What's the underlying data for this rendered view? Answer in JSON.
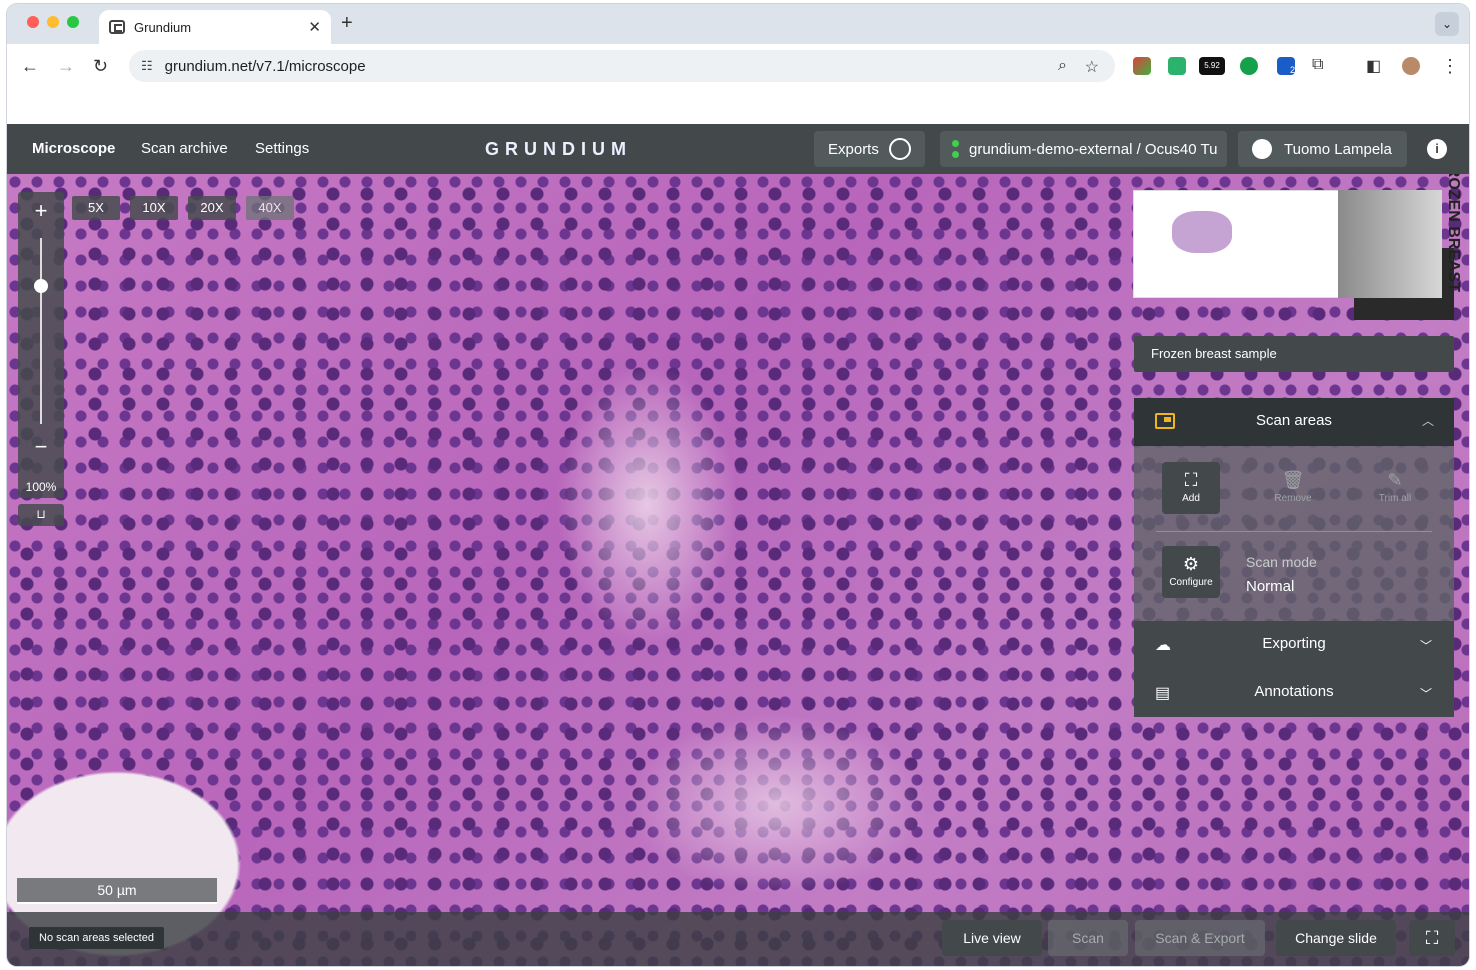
{
  "browser": {
    "tab_title": "Grundium",
    "tab_close": "✕",
    "new_tab": "+",
    "tab_menu": "⌄",
    "url": "grundium.net/v7.1/microscope",
    "ext_badge_value": "5.92",
    "ext_badge_count": "2",
    "icons": [
      "back-icon",
      "forward-icon",
      "reload-icon",
      "tune-icon",
      "zoom-icon",
      "star-icon",
      "extension-icon",
      "sidebar-icon",
      "profile-avatar",
      "more-icon"
    ]
  },
  "app": {
    "nav": {
      "microscope": "Microscope",
      "scan_archive": "Scan archive",
      "settings": "Settings"
    },
    "logo": "GRUNDIUM",
    "exports_label": "Exports",
    "device_label": "grundium-demo-external / Ocus40 Tu",
    "user_name": "Tuomo Lampela",
    "info_glyph": "i",
    "colors": {
      "header": "#43494b",
      "accent": "#f1b521",
      "online": "#3fd14c"
    }
  },
  "viewer": {
    "zoom_in": "+",
    "zoom_out": "−",
    "zoom_percent": "100%",
    "zoom_level": 0.26,
    "magnifications": [
      "5X",
      "10X",
      "20X",
      "40X"
    ],
    "active_magnification": "40X",
    "slide_label_text": "FROZEN BREAST",
    "sample_name": "Frozen breast sample",
    "scale_bar": "50 µm"
  },
  "panel": {
    "scan_areas": {
      "title": "Scan areas",
      "tools": [
        {
          "label": "Add",
          "icon": "expand-icon"
        },
        {
          "label": "Remove",
          "icon": "trash-icon"
        },
        {
          "label": "Trim all",
          "icon": "wand-icon"
        }
      ],
      "configure_label": "Configure",
      "scan_mode_label": "Scan mode",
      "scan_mode_value": "Normal"
    },
    "exporting": "Exporting",
    "annotations": "Annotations"
  },
  "bottom": {
    "status": "No scan areas selected",
    "live_view": "Live view",
    "scan": "Scan",
    "scan_export": "Scan & Export",
    "change_slide": "Change slide"
  }
}
